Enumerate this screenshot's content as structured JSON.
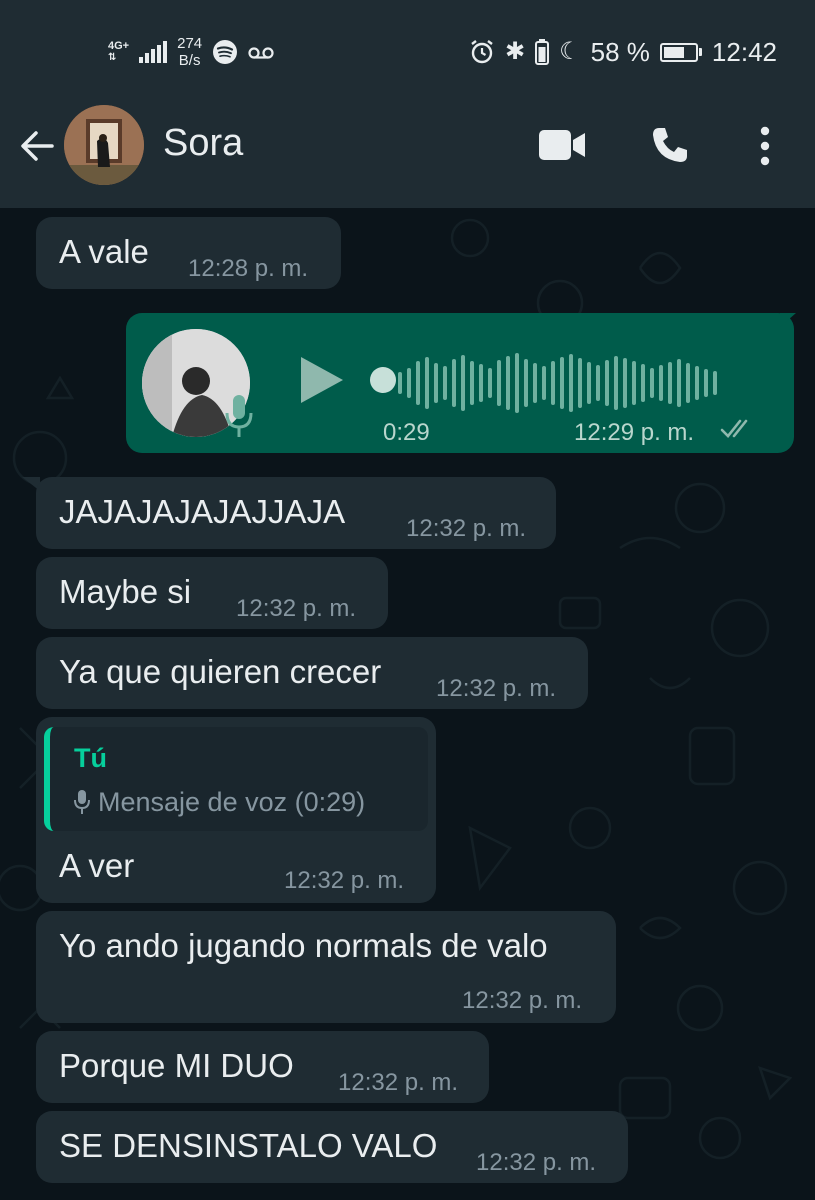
{
  "status_bar": {
    "network": "4G+",
    "speed_value": "274",
    "speed_unit": "B/s",
    "battery_percent": "58 %",
    "time": "12:42"
  },
  "header": {
    "contact_name": "Sora"
  },
  "messages": [
    {
      "text": "A vale",
      "time": "12:28 p. m."
    },
    {
      "text": "JAJAJAJAJAJJAJA",
      "time": "12:32 p. m."
    },
    {
      "text": "Maybe si",
      "time": "12:32 p. m."
    },
    {
      "text": "Ya que quieren crecer",
      "time": "12:32 p. m."
    },
    {
      "text": "A ver",
      "time": "12:32 p. m."
    },
    {
      "text": "Yo ando jugando normals de valo",
      "time": "12:32 p. m."
    },
    {
      "text": "Porque MI DUO",
      "time": "12:32 p. m."
    },
    {
      "text": "SE DENSINSTALO VALO",
      "time": "12:32 p. m."
    }
  ],
  "voice_message": {
    "duration": "0:29",
    "time": "12:29 p. m."
  },
  "quote": {
    "author": "Tú",
    "text": "Mensaje de voz (0:29)"
  },
  "colors": {
    "incoming_bubble": "#1f2c33",
    "outgoing_bubble": "#005c4b",
    "accent": "#06cf9c",
    "header": "#1f2c33"
  }
}
